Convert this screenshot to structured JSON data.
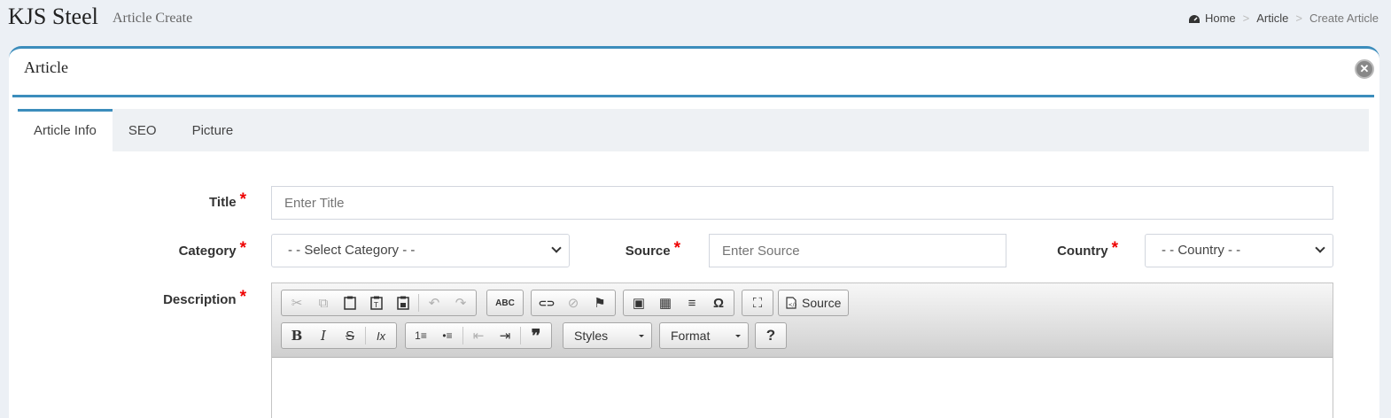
{
  "header": {
    "brand": "KJS Steel",
    "subtitle": "Article Create",
    "breadcrumb": {
      "home": "Home",
      "section": "Article",
      "current": "Create Article",
      "separator": ">"
    }
  },
  "box": {
    "title": "Article",
    "close_symbol": "✕"
  },
  "tabs": [
    {
      "label": "Article Info",
      "active": true
    },
    {
      "label": "SEO",
      "active": false
    },
    {
      "label": "Picture",
      "active": false
    }
  ],
  "form": {
    "required_mark": "*",
    "title": {
      "label": "Title",
      "placeholder": "Enter Title"
    },
    "category": {
      "label": "Category",
      "value": "- - Select Category - -"
    },
    "source": {
      "label": "Source",
      "placeholder": "Enter Source"
    },
    "country": {
      "label": "Country",
      "value": "- - Country - -"
    },
    "description": {
      "label": "Description"
    }
  },
  "editor": {
    "source_label": "Source",
    "styles_label": "Styles",
    "format_label": "Format",
    "help_label": "?",
    "glyphs": {
      "cut": "✂",
      "copy": "⧉",
      "undo": "↶",
      "redo": "↷",
      "spell": "ABC",
      "link": "⊂⊃",
      "unlink": "⊘",
      "anchor": "⚑",
      "image": "▣",
      "table": "▦",
      "hr": "≡",
      "special": "Ω",
      "maximize": "⛶",
      "bold": "B",
      "italic": "I",
      "strike": "S",
      "removeformat": "Ix",
      "ol": "1≡",
      "ul": "•≡",
      "outdent": "⇤",
      "indent": "⇥",
      "quote": "❞"
    }
  },
  "colors": {
    "accent": "#3c8dbc",
    "required": "#ee0000",
    "background": "#ecf0f5"
  }
}
